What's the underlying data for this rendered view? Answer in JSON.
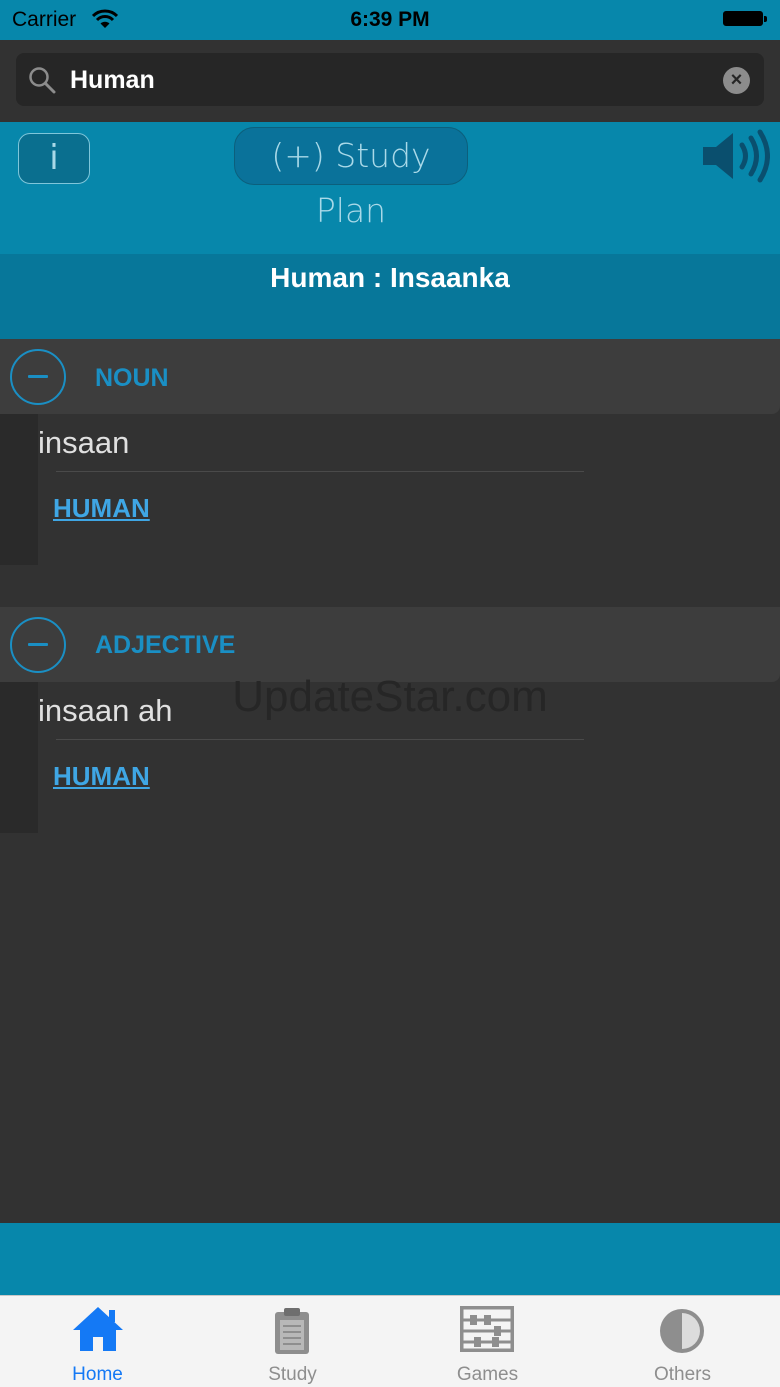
{
  "status_bar": {
    "carrier": "Carrier",
    "time": "6:39 PM"
  },
  "search": {
    "value": "Human"
  },
  "header": {
    "info_label": "i",
    "study_plan_label": "(+) Study Plan"
  },
  "title": "Human : Insaanka",
  "sections": [
    {
      "part_of_speech": "NOUN",
      "word": "insaan",
      "link": "HUMAN"
    },
    {
      "part_of_speech": "ADJECTIVE",
      "word": "insaan ah",
      "link": "HUMAN"
    }
  ],
  "watermark": "UpdateStar.com",
  "tabs": [
    {
      "label": "Home",
      "icon": "house-icon",
      "active": true
    },
    {
      "label": "Study",
      "icon": "clipboard-icon",
      "active": false
    },
    {
      "label": "Games",
      "icon": "abacus-icon",
      "active": false
    },
    {
      "label": "Others",
      "icon": "half-circle-icon",
      "active": false
    }
  ],
  "colors": {
    "accent": "#0787ab",
    "link": "#3fa6e4",
    "section_title": "#1a8fc4",
    "tab_active": "#1479f5",
    "tab_inactive": "#8e8e8e"
  }
}
